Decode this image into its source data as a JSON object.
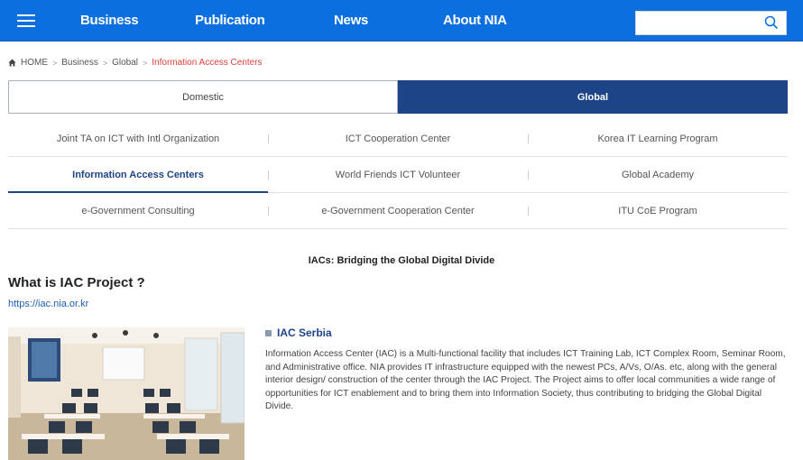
{
  "nav": {
    "items": [
      "Business",
      "Publication",
      "News",
      "About NIA"
    ],
    "search_placeholder": "",
    "color": "#0b6fe0"
  },
  "breadcrumb": {
    "home": "HOME",
    "items": [
      "Business",
      "Global"
    ],
    "current": "Information Access Centers"
  },
  "tabs": {
    "domestic": "Domestic",
    "global": "Global",
    "active": "Global",
    "active_color": "#1c4486"
  },
  "submenu": {
    "rows": [
      [
        "Joint TA on ICT with Intl Organization",
        "ICT Cooperation Center",
        "Korea IT Learning Program"
      ],
      [
        "Information Access Centers",
        "World Friends ICT Volunteer",
        "Global Academy"
      ],
      [
        "e-Government Consulting",
        "e-Government Cooperation Center",
        "ITU CoE Program"
      ]
    ],
    "active": "Information Access Centers"
  },
  "content": {
    "subtitle": "IACs: Bridging the Global Digital Divide",
    "title": "What is IAC Project ?",
    "link": "https://iac.nia.or.kr",
    "section_title": "IAC Serbia",
    "body": "Information Access Center (IAC) is a Multi-functional facility that includes ICT Training Lab, ICT Complex Room, Seminar Room, and Administrative office. NIA provides IT infrastructure equipped with the newest PCs, A/Vs, O/As. etc, along with the general interior design/ construction of the center through the IAC Project. The Project aims to offer local communities a wide range of opportunities for ICT enablement and to bring them into Information Society, thus contributing to bridging the Global Digital Divide."
  }
}
